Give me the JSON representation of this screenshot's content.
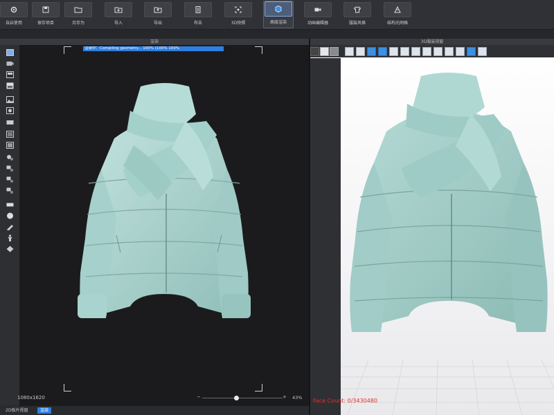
{
  "toolbar": {
    "buttons": [
      {
        "label": "自启使用",
        "icon": "gear-icon"
      },
      {
        "label": "保存项目",
        "icon": "save-icon"
      },
      {
        "label": "另存为",
        "icon": "folder-icon"
      },
      {
        "label": "导入",
        "icon": "import-icon"
      },
      {
        "label": "导出",
        "icon": "export-icon"
      },
      {
        "label": "布告",
        "icon": "document-icon"
      },
      {
        "label": "3D快照",
        "icon": "snapshot-icon"
      },
      {
        "label": "高级渲染",
        "icon": "cube-icon"
      },
      {
        "label": "动画编辑器",
        "icon": "video-icon"
      },
      {
        "label": "服装风格",
        "icon": "shirt-icon"
      },
      {
        "label": "结构光网格",
        "icon": "mesh-icon"
      }
    ]
  },
  "render_panel": {
    "title": "渲染",
    "progress_text": "渲染中：Compiling geometry... 100% (100% 100%",
    "progress": 1.0,
    "resolution": "1080x1620",
    "zoom_label": "43%",
    "zoom_minus": "−",
    "zoom_plus": "+",
    "zoom_value": 0.43
  },
  "view3d_panel": {
    "title": "3D服装视窗",
    "face_count": "Face Count: 0/3430480"
  },
  "bottom_tabs": [
    {
      "label": "2D板片视窗",
      "active": false
    },
    {
      "label": "渲染",
      "active": true
    }
  ],
  "colors": {
    "accent": "#2f7fe0",
    "garment": "#a9d3cf",
    "face_count": "#e0302a"
  }
}
